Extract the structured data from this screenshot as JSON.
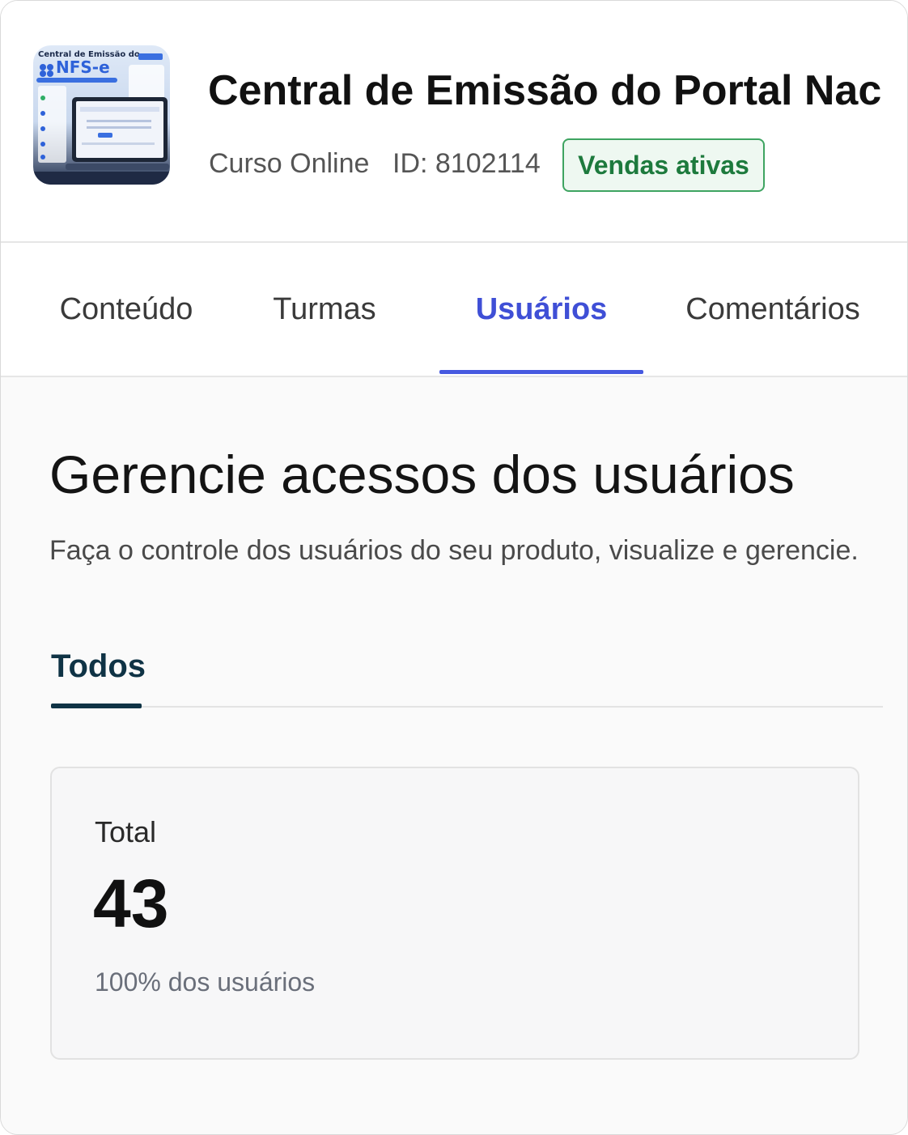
{
  "product": {
    "title": "Central de Emissão do Portal Nac",
    "type": "Curso Online",
    "id_label": "ID: 8102114",
    "status_badge": "Vendas ativas",
    "thumbnail": {
      "heading": "Central de Emissão do",
      "logo_text": "NFS-e"
    }
  },
  "tabs": [
    {
      "label": "Conteúdo",
      "active": false
    },
    {
      "label": "Turmas",
      "active": false
    },
    {
      "label": "Usuários",
      "active": true
    },
    {
      "label": "Comentários",
      "active": false
    }
  ],
  "page": {
    "heading": "Gerencie acessos dos usuários",
    "subheading": "Faça o controle dos usuários do seu produto, visualize e gerencie."
  },
  "filters": {
    "active": "Todos"
  },
  "summary_card": {
    "label": "Total",
    "value": "43",
    "footnote": "100% dos usuários"
  },
  "colors": {
    "accent": "#4659e0",
    "badge_green": "#3ea461",
    "filter_dark": "#0f3345"
  }
}
